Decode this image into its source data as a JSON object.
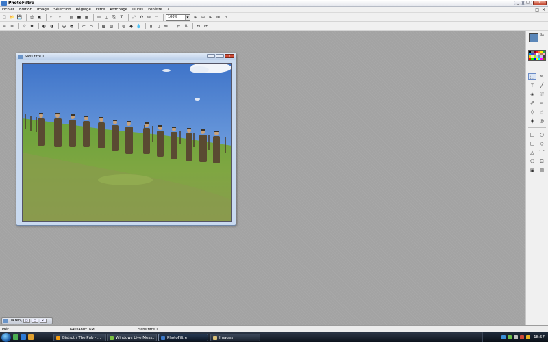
{
  "window": {
    "title": "PhotoFiltre"
  },
  "window_controls": {
    "minimize": "_",
    "maximize": "□",
    "close": "×"
  },
  "menu": {
    "items": [
      "Fichier",
      "Edition",
      "Image",
      "Sélection",
      "Réglage",
      "Filtre",
      "Affichage",
      "Outils",
      "Fenêtre",
      "?"
    ]
  },
  "toolbar": {
    "zoom": "100%"
  },
  "document": {
    "title": "Sans titre 1"
  },
  "minimized": {
    "label": "la fen\\"
  },
  "status": {
    "ready": "Prêt",
    "size": "640x480x16M",
    "name": "Sans titre 1"
  },
  "taskbar": {
    "tasks": [
      "Bistrot / The Pub - ...",
      "Windows Live Mess...",
      "PhotoFiltre",
      "Images"
    ],
    "clock": "18:57"
  },
  "colors": {
    "foreground": "#5b87b9",
    "background": "#ffffff",
    "palette": [
      "#000000",
      "#7f7f7f",
      "#880015",
      "#ed1c24",
      "#ff7f27",
      "#fff200",
      "#22b14c",
      "#00a2e8",
      "#3f48cc",
      "#a349a4",
      "#ffffff",
      "#c3c3c3",
      "#b97a57",
      "#ffaec9",
      "#ffc90e",
      "#efe4b0",
      "#b5e61d",
      "#99d9ea",
      "#7092be",
      "#c8bfe7",
      "#404040",
      "#ff0000",
      "#00ff00",
      "#0000ff",
      "#ffff00",
      "#00ffff",
      "#ff00ff",
      "#808000"
    ]
  }
}
